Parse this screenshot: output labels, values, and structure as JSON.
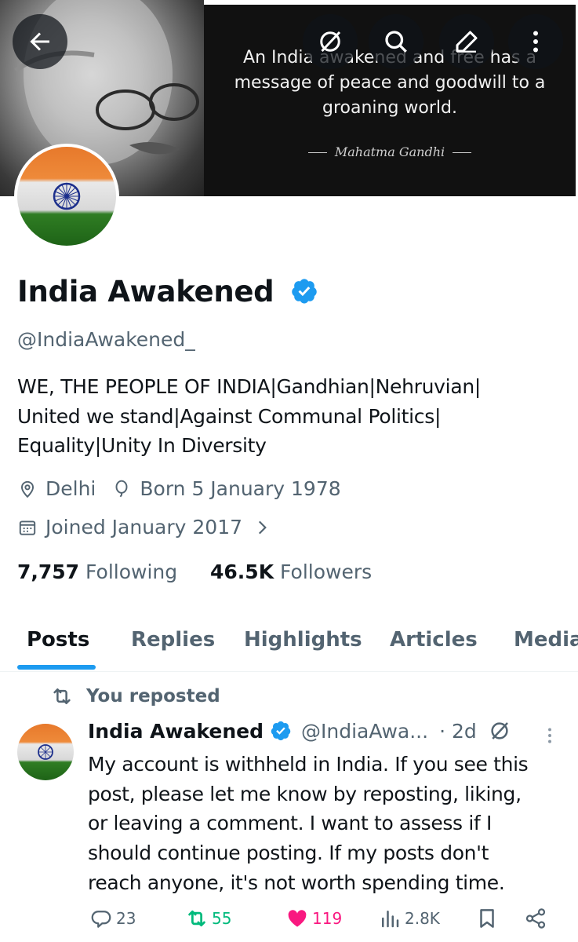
{
  "banner": {
    "quote": "An India awakened and free has a message of peace and goodwill to a groaning world.",
    "author": "Mahatma Gandhi"
  },
  "profile": {
    "name": "India Awakened",
    "handle": "@IndiaAwakened_",
    "bio": [
      "WE, THE PEOPLE OF INDIA|Gandhian|Nehruvian|",
      "United we stand|Against Communal Politics|",
      "Equality|Unity In Diversity"
    ],
    "location": "Delhi",
    "born": "Born 5 January 1978",
    "joined": "Joined January 2017",
    "following_count": "7,757",
    "following_label": "Following",
    "followers_count": "46.5K",
    "followers_label": "Followers"
  },
  "tabs": [
    {
      "label": "Posts",
      "active": true
    },
    {
      "label": "Replies"
    },
    {
      "label": "Highlights"
    },
    {
      "label": "Articles"
    },
    {
      "label": "Media"
    }
  ],
  "post": {
    "repost_label": "You reposted",
    "author_name": "India Awakened",
    "author_handle": "@IndiaAwa...",
    "time": "· 2d",
    "text": [
      "My account is withheld in India. If you see this",
      "post, please let me know by reposting, liking,",
      "or leaving a comment. I want to assess if I",
      "should continue posting. If my posts don't",
      "reach anyone, it's not worth spending time."
    ],
    "replies": "23",
    "reposts": "55",
    "likes": "119",
    "views": "2.8K"
  },
  "colors": {
    "accent": "#1d9bf0",
    "repost_green": "#00ba7c",
    "like_pink": "#f91880",
    "secondary_text": "#536471"
  }
}
